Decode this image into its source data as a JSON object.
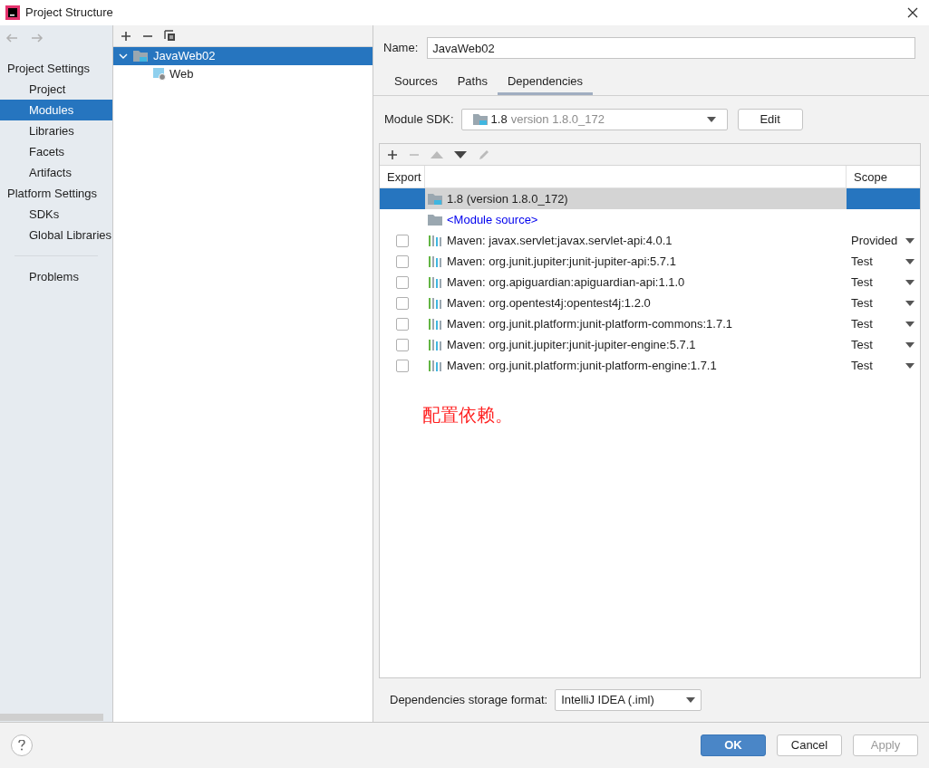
{
  "window": {
    "title": "Project Structure"
  },
  "sidebar": {
    "sections": [
      {
        "title": "Project Settings",
        "items": [
          {
            "label": "Project",
            "selected": false
          },
          {
            "label": "Modules",
            "selected": true
          },
          {
            "label": "Libraries",
            "selected": false
          },
          {
            "label": "Facets",
            "selected": false
          },
          {
            "label": "Artifacts",
            "selected": false
          }
        ]
      },
      {
        "title": "Platform Settings",
        "items": [
          {
            "label": "SDKs",
            "selected": false
          },
          {
            "label": "Global Libraries",
            "selected": false
          }
        ]
      }
    ],
    "bottom_items": [
      {
        "label": "Problems",
        "selected": false
      }
    ]
  },
  "tree": [
    {
      "label": "JavaWeb02",
      "selected": true,
      "expanded": true,
      "children": [
        {
          "label": "Web",
          "selected": false
        }
      ]
    }
  ],
  "name_field": {
    "label": "Name:",
    "value": "JavaWeb02"
  },
  "tabs": [
    {
      "label": "Sources",
      "selected": false
    },
    {
      "label": "Paths",
      "selected": false
    },
    {
      "label": "Dependencies",
      "selected": true
    }
  ],
  "module_sdk": {
    "label": "Module SDK:",
    "value": "1.8",
    "detail": "version 1.8.0_172",
    "edit_button": "Edit"
  },
  "dependencies": {
    "columns": [
      "Export",
      "Scope"
    ],
    "rows": [
      {
        "kind": "sdk",
        "name": "1.8 (version 1.8.0_172)",
        "selected": true
      },
      {
        "kind": "source",
        "name": "<Module source>",
        "selected": false
      },
      {
        "kind": "library",
        "name": "Maven: javax.servlet:javax.servlet-api:4.0.1",
        "scope": "Provided",
        "checked": false,
        "selected": false
      },
      {
        "kind": "library",
        "name": "Maven: org.junit.jupiter:junit-jupiter-api:5.7.1",
        "scope": "Test",
        "checked": false,
        "selected": false
      },
      {
        "kind": "library",
        "name": "Maven: org.apiguardian:apiguardian-api:1.1.0",
        "scope": "Test",
        "checked": false,
        "selected": false
      },
      {
        "kind": "library",
        "name": "Maven: org.opentest4j:opentest4j:1.2.0",
        "scope": "Test",
        "checked": false,
        "selected": false
      },
      {
        "kind": "library",
        "name": "Maven: org.junit.platform:junit-platform-commons:1.7.1",
        "scope": "Test",
        "checked": false,
        "selected": false
      },
      {
        "kind": "library",
        "name": "Maven: org.junit.jupiter:junit-jupiter-engine:5.7.1",
        "scope": "Test",
        "checked": false,
        "selected": false
      },
      {
        "kind": "library",
        "name": "Maven: org.junit.platform:junit-platform-engine:1.7.1",
        "scope": "Test",
        "checked": false,
        "selected": false
      }
    ]
  },
  "annotation": "配置依赖。",
  "storage_format": {
    "label": "Dependencies storage format:",
    "value": "IntelliJ IDEA (.iml)"
  },
  "buttons": [
    {
      "label": "OK",
      "kind": "primary",
      "disabled": false
    },
    {
      "label": "Cancel",
      "kind": "normal",
      "disabled": false
    },
    {
      "label": "Apply",
      "kind": "normal",
      "disabled": true
    }
  ]
}
